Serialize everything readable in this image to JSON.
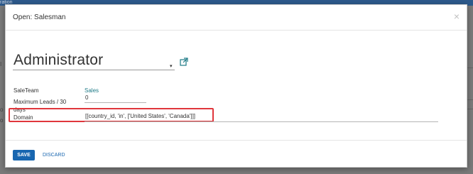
{
  "background": {
    "topbar_text": "ration",
    "left_fragments": [
      "I",
      "o",
      "o"
    ],
    "accent": "#2d5a8c"
  },
  "dialog": {
    "title": "Open: Salesman",
    "close_icon": "close-icon"
  },
  "form": {
    "name_value": "Administrator",
    "name_caret": "▾",
    "external_link_icon": "external-link-icon",
    "sales_team": {
      "label": "SaleTeam",
      "value": "Sales"
    },
    "max_leads": {
      "label_line1": "Maximum Leads / 30",
      "label_line2": "days",
      "value": "0"
    },
    "domain": {
      "label": "Domain",
      "value": "[[country_id, 'in', ['United States', 'Canada']]]"
    }
  },
  "footer": {
    "save_label": "SAVE",
    "discard_label": "DISCARD"
  },
  "colors": {
    "primary": "#1866b0",
    "link": "#1d7a86",
    "highlight": "#e0363c"
  }
}
